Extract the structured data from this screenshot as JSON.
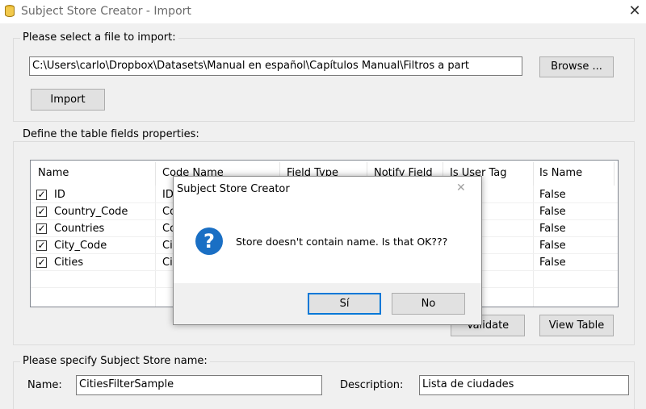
{
  "window": {
    "title": "Subject Store Creator - Import",
    "close_glyph": "✕"
  },
  "import_group": {
    "label": "Please select a file to import:",
    "file_path": "C:\\Users\\carlo\\Dropbox\\Datasets\\Manual en español\\Capítulos Manual\\Filtros a part",
    "browse_label": "Browse ...",
    "import_label": "Import"
  },
  "fields_group": {
    "label": "Define the table fields properties:",
    "columns": [
      "Name",
      "Code Name",
      "Field Type",
      "Notify Field",
      "Is User Tag",
      "Is Name"
    ],
    "rows": [
      {
        "name": "ID",
        "code": "ID",
        "is_name": "False",
        "checked": true
      },
      {
        "name": "Country_Code",
        "code": "Co",
        "is_name": "False",
        "checked": true
      },
      {
        "name": "Countries",
        "code": "Co",
        "is_name": "False",
        "checked": true
      },
      {
        "name": "City_Code",
        "code": "Ci",
        "is_name": "False",
        "checked": true
      },
      {
        "name": "Cities",
        "code": "Ci",
        "is_name": "False",
        "checked": true
      }
    ],
    "validate_label": "Validate",
    "view_table_label": "View Table"
  },
  "store_group": {
    "label": "Please specify Subject Store name:",
    "name_label": "Name:",
    "name_value": "CitiesFilterSample",
    "description_label": "Description:",
    "description_value": "Lista de ciudades"
  },
  "dialog": {
    "title": "Subject Store Creator",
    "close_glyph": "✕",
    "icon_glyph": "?",
    "message": "Store doesn't contain name. Is that OK???",
    "yes_label": "Sí",
    "no_label": "No"
  },
  "check_glyph": "✓",
  "colors": {
    "accent": "#0078d7",
    "question_icon": "#1a6fc4",
    "window_bg": "#f0f0f0"
  }
}
